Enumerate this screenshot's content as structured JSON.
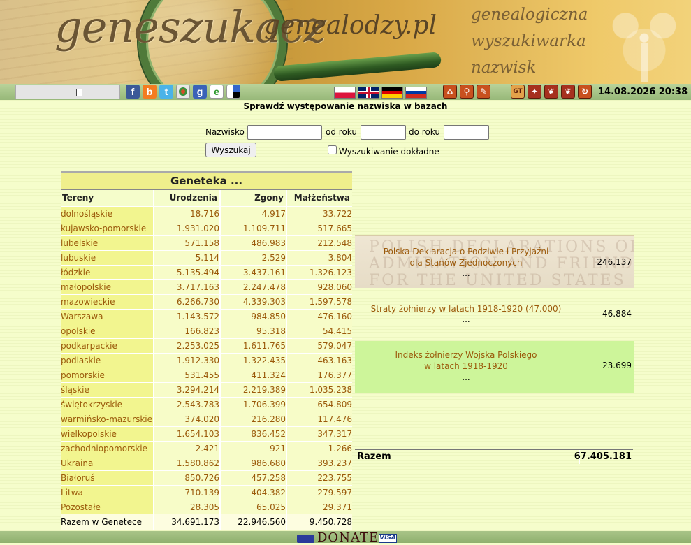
{
  "banner": {
    "logo_main": "geneszukacz",
    "logo_site": "genealodzy.pl",
    "tagline_1": "genealogiczna",
    "tagline_2": "wyszukiwarka",
    "tagline_3": "nazwisk"
  },
  "toolbar": {
    "social_icons": [
      "facebook-icon",
      "blogger-icon",
      "twitter-icon",
      "google-reader-icon",
      "google-icon",
      "netvibes-icon",
      "delicious-icon"
    ],
    "flags": [
      "polish-flag",
      "english-flag",
      "german-flag",
      "russian-flag"
    ],
    "nav_icons": [
      "home-icon",
      "search-tool-icon",
      "edit-tool-icon",
      "geneteka-icon",
      "genealogy-icon",
      "eagle-icon",
      "eagle-icon-2",
      "refresh-icon"
    ],
    "datetime": "14.08.2026 20:38"
  },
  "search": {
    "title": "Sprawdź występowanie nazwiska w bazach",
    "surname_label": "Nazwisko",
    "from_year_label": "od roku",
    "to_year_label": "do roku",
    "surname_value": "",
    "from_year_value": "",
    "to_year_value": "",
    "button_label": "Wyszukaj",
    "exact_label": "Wyszukiwanie dokładne"
  },
  "geneteka": {
    "title": "Geneteka ...",
    "headers": [
      "Tereny",
      "Urodzenia",
      "Zgony",
      "Małżeństwa"
    ],
    "rows": [
      {
        "name": "dolnośląskie",
        "births": "18.716",
        "deaths": "4.917",
        "marriages": "33.722"
      },
      {
        "name": "kujawsko-pomorskie",
        "births": "1.931.020",
        "deaths": "1.109.711",
        "marriages": "517.665"
      },
      {
        "name": "lubelskie",
        "births": "571.158",
        "deaths": "486.983",
        "marriages": "212.548"
      },
      {
        "name": "lubuskie",
        "births": "5.114",
        "deaths": "2.529",
        "marriages": "3.804"
      },
      {
        "name": "łódzkie",
        "births": "5.135.494",
        "deaths": "3.437.161",
        "marriages": "1.326.123"
      },
      {
        "name": "małopolskie",
        "births": "3.717.163",
        "deaths": "2.247.478",
        "marriages": "928.060"
      },
      {
        "name": "mazowieckie",
        "births": "6.266.730",
        "deaths": "4.339.303",
        "marriages": "1.597.578"
      },
      {
        "name": "Warszawa",
        "births": "1.143.572",
        "deaths": "984.850",
        "marriages": "476.160"
      },
      {
        "name": "opolskie",
        "births": "166.823",
        "deaths": "95.318",
        "marriages": "54.415"
      },
      {
        "name": "podkarpackie",
        "births": "2.253.025",
        "deaths": "1.611.765",
        "marriages": "579.047"
      },
      {
        "name": "podlaskie",
        "births": "1.912.330",
        "deaths": "1.322.435",
        "marriages": "463.163"
      },
      {
        "name": "pomorskie",
        "births": "531.455",
        "deaths": "411.324",
        "marriages": "176.377"
      },
      {
        "name": "śląskie",
        "births": "3.294.214",
        "deaths": "2.219.389",
        "marriages": "1.035.238"
      },
      {
        "name": "świętokrzyskie",
        "births": "2.543.783",
        "deaths": "1.706.399",
        "marriages": "654.809"
      },
      {
        "name": "warmińsko-mazurskie",
        "births": "374.020",
        "deaths": "216.280",
        "marriages": "117.476"
      },
      {
        "name": "wielkopolskie",
        "births": "1.654.103",
        "deaths": "836.452",
        "marriages": "347.317"
      },
      {
        "name": "zachodniopomorskie",
        "births": "2.421",
        "deaths": "921",
        "marriages": "1.266"
      },
      {
        "name": "Ukraina",
        "births": "1.580.862",
        "deaths": "986.680",
        "marriages": "393.237"
      },
      {
        "name": "Białoruś",
        "births": "850.726",
        "deaths": "457.258",
        "marriages": "223.755"
      },
      {
        "name": "Litwa",
        "births": "710.139",
        "deaths": "404.382",
        "marriages": "279.597"
      },
      {
        "name": "Pozostałe",
        "births": "28.305",
        "deaths": "65.025",
        "marriages": "29.371"
      }
    ],
    "total": {
      "name": "Razem w Genetece",
      "births": "34.691.173",
      "deaths": "22.946.560",
      "marriages": "9.450.728"
    }
  },
  "databases": [
    {
      "title_line1": "Polska Deklaracja o Podziwie i Przyjaźni",
      "title_line2": "dla Stanów Zjednoczonych",
      "dots": "...",
      "count": "246.137",
      "decor_1": "POLISH DECLARATIONS OF",
      "decor_2": "ADMIRATION AND FRIENDSHIP",
      "decor_3": "FOR THE UNITED STATES"
    },
    {
      "title_line1": "Straty żołnierzy w latach 1918-1920 (47.000)",
      "dots": "...",
      "count": "46.884"
    },
    {
      "title_line1": "Indeks żołnierzy Wojska Polskiego",
      "title_line2": "w latach 1918-1920",
      "dots": "...",
      "count": "23.699"
    }
  ],
  "summary": {
    "label": "Razem",
    "value": "67.405.181"
  },
  "footer": {
    "donate_label": "DONATE",
    "visa_label": "VISA"
  }
}
